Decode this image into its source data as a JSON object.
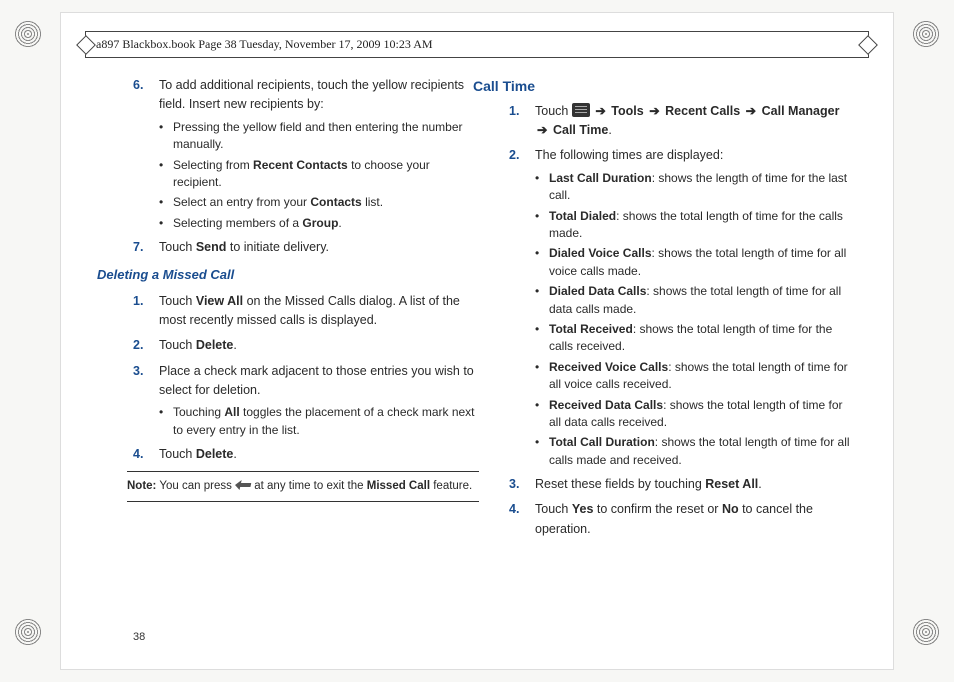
{
  "header": "a897 Blackbox.book  Page 38  Tuesday, November 17, 2009  10:23 AM",
  "page_number": "38",
  "left": {
    "step6_num": "6.",
    "step6": "To add additional recipients, touch the yellow recipients field. Insert new recipients by:",
    "step6_b1": "Pressing the yellow field and then entering the number manually.",
    "step6_b2a": "Selecting from ",
    "step6_b2b": "Recent Contacts",
    "step6_b2c": " to choose your recipient.",
    "step6_b3a": "Select an entry from your ",
    "step6_b3b": "Contacts",
    "step6_b3c": " list.",
    "step6_b4a": "Selecting members of a ",
    "step6_b4b": "Group",
    "step6_b4c": ".",
    "step7_num": "7.",
    "step7a": "Touch ",
    "step7b": "Send",
    "step7c": " to initiate delivery.",
    "del_h": "Deleting a Missed Call",
    "d1_num": "1.",
    "d1a": "Touch ",
    "d1b": "View All",
    "d1c": " on the Missed Calls dialog. A list of the most recently missed calls is displayed.",
    "d2_num": "2.",
    "d2a": "Touch ",
    "d2b": "Delete",
    "d2c": ".",
    "d3_num": "3.",
    "d3": "Place a check mark adjacent to those entries you wish to select for deletion.",
    "d3_b1a": "Touching ",
    "d3_b1b": "All",
    "d3_b1c": " toggles the placement of a check mark next to every entry in the list.",
    "d4_num": "4.",
    "d4a": "Touch ",
    "d4b": "Delete",
    "d4c": ".",
    "note_lbl": "Note:",
    "note_a": " You can press ",
    "note_b": " at any time to exit the ",
    "note_c": "Missed Call",
    "note_d": " feature."
  },
  "right": {
    "h": "Call Time",
    "r1_num": "1.",
    "r1a": "Touch ",
    "arrow": "➔",
    "r1_tools": "Tools",
    "r1_recent": "Recent Calls",
    "r1_cm": "Call Manager",
    "r1_ct": "Call Time",
    "r1_dot": ".",
    "r2_num": "2.",
    "r2": "The following times are displayed:",
    "b1a": "Last Call Duration",
    "b1b": ": shows the length of time for the last call.",
    "b2a": "Total Dialed",
    "b2b": ": shows the total length of time for the calls made.",
    "b3a": "Dialed Voice Calls",
    "b3b": ": shows the total length of time for all voice calls made.",
    "b4a": "Dialed Data Calls",
    "b4b": ": shows the total length of time for all data calls made.",
    "b5a": "Total Received",
    "b5b": ": shows the total length of time for the calls received.",
    "b6a": "Received Voice Calls",
    "b6b": ": shows the total length of time for all voice calls received.",
    "b7a": "Received Data Calls",
    "b7b": ": shows the total length of time for all data calls received.",
    "b8a": "Total Call Duration",
    "b8b": ": shows the total length of time for all calls made and received.",
    "r3_num": "3.",
    "r3a": "Reset these fields by touching ",
    "r3b": "Reset All",
    "r3c": ".",
    "r4_num": "4.",
    "r4a": "Touch ",
    "r4b": "Yes",
    "r4c": " to confirm the reset or ",
    "r4d": "No",
    "r4e": " to cancel the operation."
  }
}
